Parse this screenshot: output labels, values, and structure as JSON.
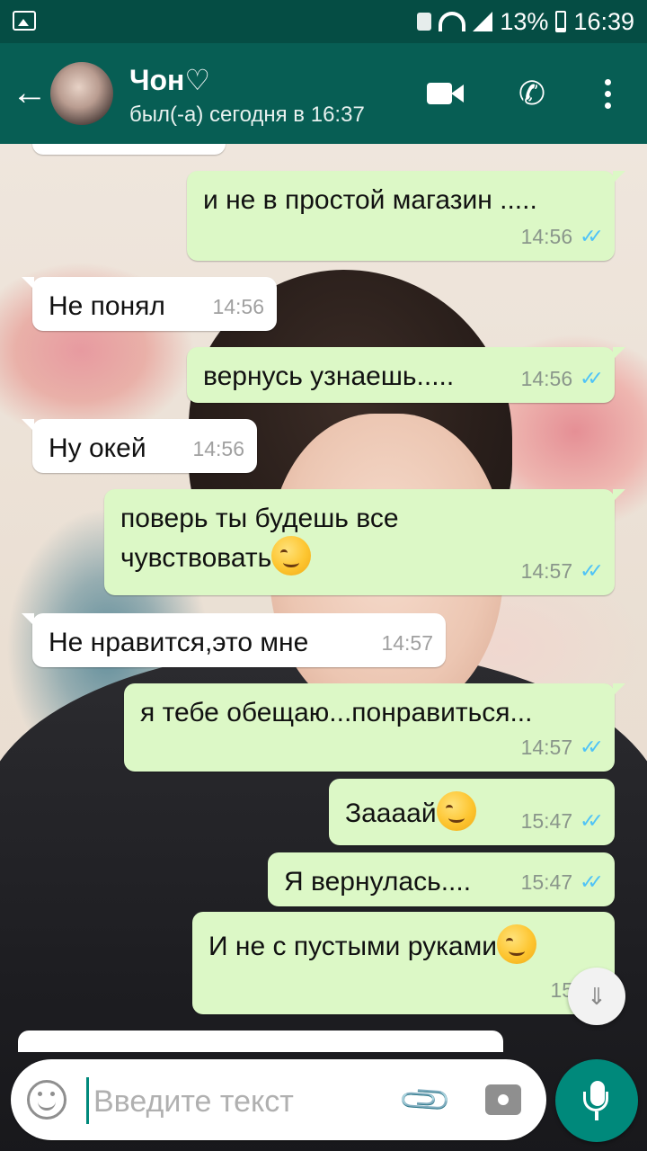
{
  "status_bar": {
    "battery_percent": "13%",
    "time": "16:39"
  },
  "header": {
    "back_icon": "arrow-left-icon",
    "contact_name": "Чон♡",
    "last_seen": "был(-а) сегодня в 16:37",
    "video_icon": "video-camera-icon",
    "call_icon": "phone-icon",
    "menu_icon": "more-vertical-icon"
  },
  "messages": [
    {
      "direction": "out",
      "text": "и не в простой магазин .....",
      "time": "14:56",
      "status": "read"
    },
    {
      "direction": "in",
      "text": "Не понял",
      "time": "14:56"
    },
    {
      "direction": "out",
      "text": "вернусь узнаешь.....",
      "time": "14:56",
      "status": "read"
    },
    {
      "direction": "in",
      "text": "Ну окей",
      "time": "14:56"
    },
    {
      "direction": "out",
      "text": "поверь ты будешь все чувствовать",
      "emoji": "smirking-face",
      "time": "14:57",
      "status": "read"
    },
    {
      "direction": "in",
      "text": "Не нравится,это мне",
      "time": "14:57"
    },
    {
      "direction": "out",
      "text": "я тебе обещаю...понравиться...",
      "time": "14:57",
      "status": "read"
    },
    {
      "direction": "out",
      "text": "Заааай",
      "emoji": "smiling-face",
      "time": "15:47",
      "status": "read"
    },
    {
      "direction": "out",
      "text": "Я вернулась....",
      "time": "15:47",
      "status": "read"
    },
    {
      "direction": "out",
      "text": "И не с пустыми руками",
      "emoji": "smirking-face",
      "time": "15:47",
      "status": "read"
    }
  ],
  "input_bar": {
    "placeholder": "Введите текст",
    "emoji_icon": "emoji-icon",
    "attach_icon": "paperclip-icon",
    "camera_icon": "camera-icon",
    "mic_icon": "microphone-icon"
  },
  "scroll_down_icon": "double-chevron-down-icon",
  "colors": {
    "header": "#075e54",
    "status_bar": "#054d44",
    "outgoing_bubble": "#dcf8c6",
    "incoming_bubble": "#ffffff",
    "read_ticks": "#4fc3f7",
    "mic_button": "#00897b"
  }
}
